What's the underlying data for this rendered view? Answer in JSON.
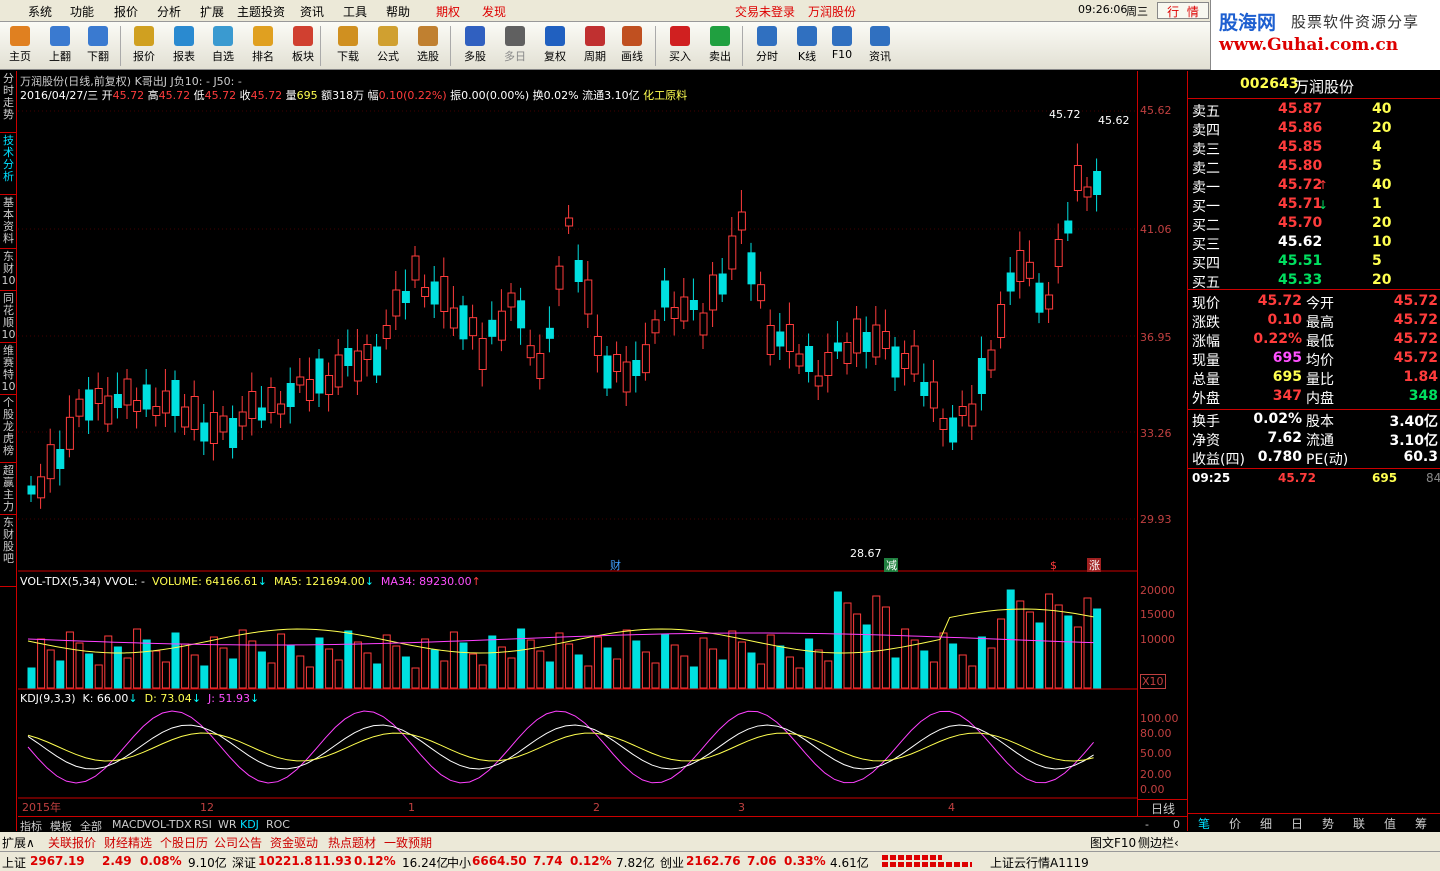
{
  "menu": {
    "items": [
      "系统",
      "功能",
      "报价",
      "分析",
      "扩展",
      "主题投资",
      "资讯",
      "工具",
      "帮助"
    ],
    "qiquan": "期权",
    "faxian": "发现",
    "login": "交易未登录",
    "stock_title": "万润股份",
    "time": "09:26:06",
    "weekday": "周三",
    "hq": "行",
    "qing": "情"
  },
  "toolbar": {
    "buttons": [
      "主页",
      "上翻",
      "下翻",
      "报价",
      "报表",
      "自选",
      "排名",
      "板块",
      "下载",
      "公式",
      "选股",
      "多股",
      "多日",
      "复权",
      "周期",
      "画线",
      "买入",
      "卖出",
      "分时",
      "K线",
      "F10",
      "资讯"
    ]
  },
  "logo": {
    "brand": "股海网",
    "slogan": "股票软件资源分享",
    "url": "www.Guhai.com.cn"
  },
  "sidetabs": [
    "分时走势",
    "技术分析",
    "基本资料",
    "东财10",
    "同花顺10",
    "维赛特10",
    "个股龙虎榜",
    "超赢主力",
    "东财股吧"
  ],
  "chart_header": {
    "line1": "万润股份(日线,前复权) K哥出J  J负10: -  J50: -",
    "date": "2016/04/27/三",
    "open_l": "开",
    "open": "45.72",
    "high_l": "高",
    "high": "45.72",
    "low_l": "低",
    "low": "45.72",
    "close_l": "收",
    "close": "45.72",
    "vol_l": "量",
    "vol": "695",
    "amt": "额318万",
    "fu_l": "幅",
    "fu": "0.10(0.22%)",
    "zhen": "振0.00(0.00%)",
    "huan": "换0.02%",
    "liutong": "流通3.10亿",
    "sector": "化工原料"
  },
  "chart_marks": {
    "max_label": "45.72",
    "max_label2": "45.62",
    "min_label": "28.67",
    "cai": "财",
    "jian": "减",
    "zhang": "涨",
    "dollar": "$"
  },
  "volume_header": {
    "name": "VOL-TDX(5,34)",
    "vvol": "VVOL: -",
    "volume": "VOLUME: 64166.61",
    "ma5": "MA5: 121694.00",
    "ma34": "MA34: 89230.00"
  },
  "kdj_header": {
    "name": "KDJ(9,3,3)",
    "k": "K: 66.00",
    "d": "D: 73.04",
    "j": "J: 51.93"
  },
  "price_axis": [
    "45.62",
    "41.06",
    "36.95",
    "33.26",
    "29.93"
  ],
  "vol_axis": [
    "20000",
    "15000",
    "10000",
    "X10"
  ],
  "kdj_axis": [
    "100.00",
    "80.00",
    "50.00",
    "20.00",
    "0.00"
  ],
  "date_axis": [
    "2015年",
    "12",
    "1",
    "2",
    "3",
    "4"
  ],
  "axis_controls": {
    "period": "日线",
    "minus": "-",
    "zero": "0"
  },
  "bottom_tabs": [
    "指标",
    "模板",
    "全部",
    "MACD",
    "VOL-TDX",
    "RSI",
    "WR",
    "KDJ",
    "ROC"
  ],
  "status_tabs": [
    "扩展∧",
    "关联报价",
    "财经精选",
    "个股日历",
    "公司公告",
    "资金驱动",
    "热点题材",
    "一致预期"
  ],
  "status_right": [
    "图文F10",
    "侧边栏‹"
  ],
  "quote_tabs": [
    "笔",
    "价",
    "细",
    "日",
    "势",
    "联",
    "值",
    "筹"
  ],
  "quote": {
    "code": "002643",
    "name": "万润股份",
    "sell": [
      {
        "l": "卖五",
        "p": "45.87",
        "v": "40"
      },
      {
        "l": "卖四",
        "p": "45.86",
        "v": "20"
      },
      {
        "l": "卖三",
        "p": "45.85",
        "v": "4"
      },
      {
        "l": "卖二",
        "p": "45.80",
        "v": "5"
      },
      {
        "l": "卖一",
        "p": "45.72",
        "v": "40"
      }
    ],
    "buy": [
      {
        "l": "买一",
        "p": "45.71",
        "v": "1"
      },
      {
        "l": "买二",
        "p": "45.70",
        "v": "20"
      },
      {
        "l": "买三",
        "p": "45.62",
        "v": "10"
      },
      {
        "l": "买四",
        "p": "45.51",
        "v": "5"
      },
      {
        "l": "买五",
        "p": "45.33",
        "v": "20"
      }
    ],
    "stats": [
      [
        "现价",
        "45.72",
        "今开",
        "45.72"
      ],
      [
        "涨跌",
        "0.10",
        "最高",
        "45.72"
      ],
      [
        "涨幅",
        "0.22%",
        "最低",
        "45.72"
      ],
      [
        "现量",
        "695",
        "均价",
        "45.72"
      ],
      [
        "总量",
        "695",
        "量比",
        "1.84"
      ],
      [
        "外盘",
        "347",
        "内盘",
        "348"
      ]
    ],
    "stats2": [
      [
        "换手",
        "0.02%",
        "股本",
        "3.40亿"
      ],
      [
        "净资",
        "7.62",
        "流通",
        "3.10亿"
      ],
      [
        "收益(四)",
        "0.780",
        "PE(动)",
        "60.3"
      ]
    ],
    "tick": {
      "time": "09:25",
      "price": "45.72",
      "vol": "695",
      "n": "84"
    }
  },
  "status": {
    "sh_l": "上证",
    "sh": "2967.19",
    "sh_c": "2.49",
    "sh_p": "0.08%",
    "sh_a": "9.10亿",
    "sz_l": "深证",
    "sz": "10221.8",
    "sz_c": "11.93",
    "sz_p": "0.12%",
    "sz_a": "16.24亿",
    "zx_l": "中小",
    "zx": "6664.50",
    "zx_c": "7.74",
    "zx_p": "0.12%",
    "zx_a": "7.82亿",
    "cy_l": "创业",
    "cy": "2162.76",
    "cy_c": "7.06",
    "cy_p": "0.33%",
    "cy_a": "4.61亿",
    "cloud": "上证云行情A1119"
  },
  "colors": {
    "up": "#ff3c3c",
    "down": "#00e0e0",
    "ma_yellow": "#ffff50",
    "ma_mag": "#ff40ff"
  }
}
